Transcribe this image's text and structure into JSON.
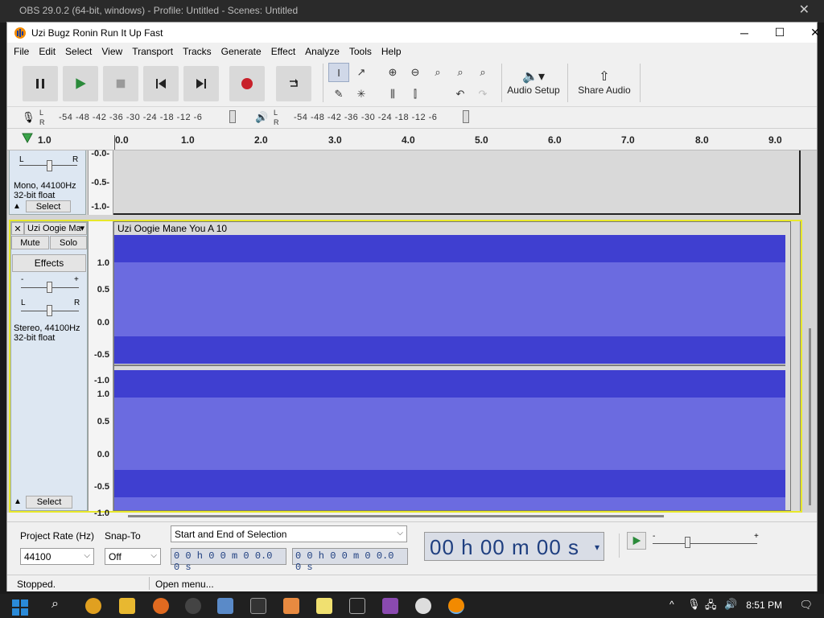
{
  "background_window": {
    "title": "OBS 29.0.2 (64-bit, windows) - Profile: Untitled - Scenes: Untitled"
  },
  "window": {
    "title": "Uzi Bugz Ronin Run It Up Fast",
    "minimize": "─",
    "maximize": "☐",
    "close": "✕"
  },
  "menu": [
    "File",
    "Edit",
    "Select",
    "View",
    "Transport",
    "Tracks",
    "Generate",
    "Effect",
    "Analyze",
    "Tools",
    "Help"
  ],
  "toolbar": {
    "audio_setup_label": "Audio Setup",
    "share_audio_label": "Share Audio"
  },
  "meters": {
    "record_ticks": "-54  -48  -42  -36  -30  -24  -18  -12   -6",
    "play_ticks": "-54  -48  -42  -36  -30  -24  -18  -12   -6",
    "l": "L",
    "r": "R"
  },
  "ruler": {
    "labels": [
      "1.0",
      "0.0",
      "1.0",
      "2.0",
      "3.0",
      "4.0",
      "5.0",
      "6.0",
      "7.0",
      "8.0",
      "9.0"
    ]
  },
  "track1": {
    "info_line1": "Mono, 44100Hz",
    "info_line2": "32-bit float",
    "select_label": "Select",
    "pan_l": "L",
    "pan_r": "R",
    "scale": [
      "-0.0-",
      "-0.5-",
      "-1.0-"
    ]
  },
  "track2": {
    "name": "Uzi Oogie Ma",
    "clip_name": "Uzi Oogie Mane You A 10",
    "mute_label": "Mute",
    "solo_label": "Solo",
    "effects_label": "Effects",
    "gain_minus": "-",
    "gain_plus": "+",
    "pan_l": "L",
    "pan_r": "R",
    "info_line1": "Stereo, 44100Hz",
    "info_line2": "32-bit float",
    "select_label": "Select",
    "scale_top": [
      "1.0",
      "0.5",
      "0.0",
      "-0.5",
      "-1.0"
    ],
    "scale_bottom": [
      "1.0",
      "0.5",
      "0.0",
      "-0.5",
      "-1.0"
    ],
    "waveform_color": "#3f3fd0",
    "waveform_light": "#6b6be0"
  },
  "selection": {
    "project_rate_label": "Project Rate (Hz)",
    "project_rate_value": "44100",
    "snap_to_label": "Snap-To",
    "snap_to_value": "Off",
    "selection_mode": "Start and End of Selection",
    "start_time": "0 0 h 0 0 m 0 0.0 0 s",
    "end_time": "0 0 h 0 0 m 0 0.0 0 s",
    "big_time": "00 h 00 m 00 s",
    "speed_minus": "-",
    "speed_plus": "+"
  },
  "status": {
    "left": "Stopped.",
    "right": "Open menu..."
  },
  "taskbar": {
    "time": "8:51 PM"
  }
}
